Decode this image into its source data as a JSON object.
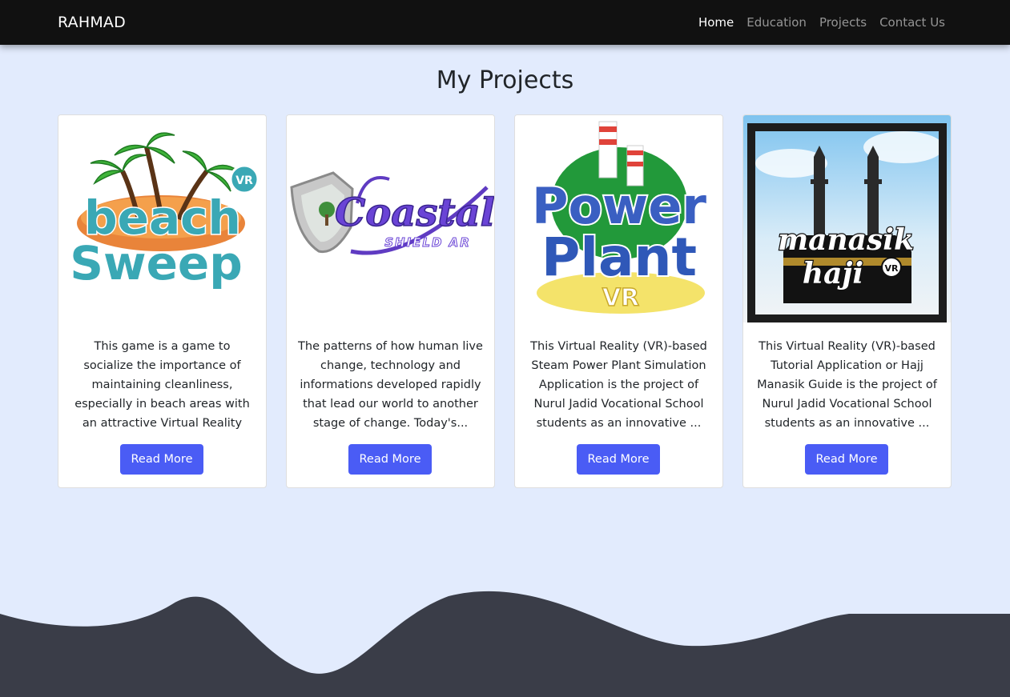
{
  "nav": {
    "brand": "RAHMAD",
    "links": [
      "Home",
      "Education",
      "Projects",
      "Contact Us"
    ],
    "active": "Home"
  },
  "page": {
    "title": "My Projects"
  },
  "cards": [
    {
      "logo_text": [
        "beach",
        "Sweep",
        "VR"
      ],
      "description": "This game is a game to socialize the importance of maintaining cleanliness, especially in beach areas with an attractive Virtual Reality technology where...",
      "button": "Read More"
    },
    {
      "logo_text": [
        "Coastal",
        "SHIELD AR"
      ],
      "description": "The patterns of how human live change, technology and informations developed rapidly that lead our world to another stage of change. Today's...",
      "button": "Read More"
    },
    {
      "logo_text": [
        "Power",
        "Plant",
        "VR"
      ],
      "description": "This Virtual Reality (VR)-based Steam Power Plant Simulation Application is the project of Nurul Jadid Vocational School students as an innovative ...",
      "button": "Read More"
    },
    {
      "logo_text": [
        "manasik",
        "haji",
        "VR"
      ],
      "description": "This Virtual Reality (VR)-based Tutorial Application or Hajj Manasik Guide is the project of Nurul Jadid Vocational School students as an innovative ...",
      "button": "Read More"
    }
  ],
  "colors": {
    "navbar": "#111111",
    "background": "#e2ebfd",
    "button": "#4a5cf5",
    "footer_wave": "#3a3d48"
  }
}
